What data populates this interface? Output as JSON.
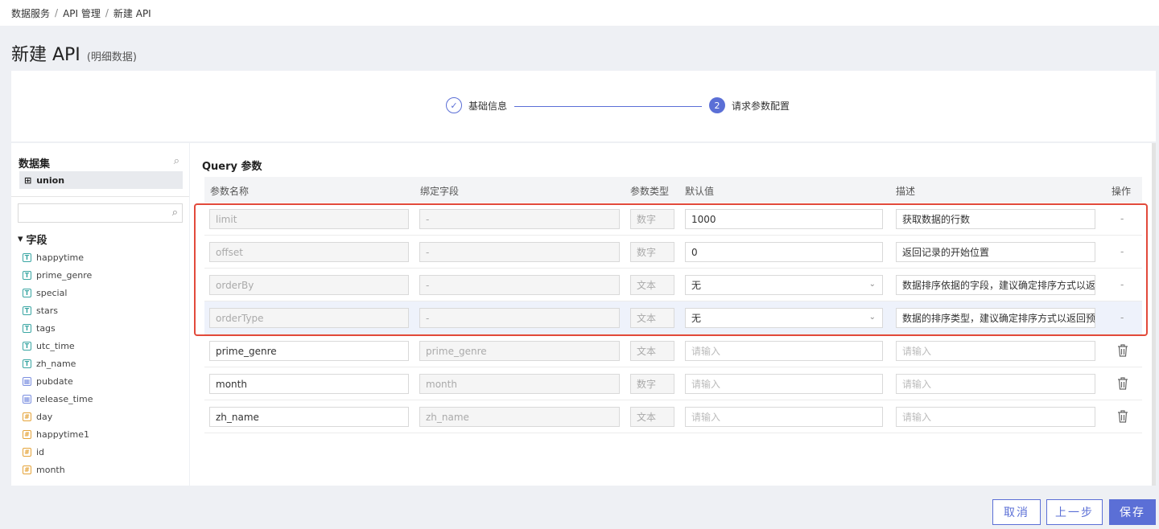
{
  "breadcrumb": [
    "数据服务",
    "API 管理",
    "新建 API"
  ],
  "page": {
    "title": "新建 API",
    "subtitle": "(明细数据)"
  },
  "steps": [
    {
      "label": "基础信息",
      "status": "done"
    },
    {
      "label": "请求参数配置",
      "number": "2",
      "status": "active"
    }
  ],
  "dataset": {
    "header": "数据集",
    "item": "union",
    "fields_group": "字段"
  },
  "fields": [
    {
      "name": "happytime",
      "type": "T"
    },
    {
      "name": "prime_genre",
      "type": "T"
    },
    {
      "name": "special",
      "type": "T"
    },
    {
      "name": "stars",
      "type": "T"
    },
    {
      "name": "tags",
      "type": "T"
    },
    {
      "name": "utc_time",
      "type": "T"
    },
    {
      "name": "zh_name",
      "type": "T"
    },
    {
      "name": "pubdate",
      "type": "date"
    },
    {
      "name": "release_time",
      "type": "date"
    },
    {
      "name": "day",
      "type": "#"
    },
    {
      "name": "happytime1",
      "type": "#"
    },
    {
      "name": "id",
      "type": "#"
    },
    {
      "name": "month",
      "type": "#"
    }
  ],
  "query": {
    "title": "Query 参数",
    "headers": [
      "参数名称",
      "绑定字段",
      "参数类型",
      "默认值",
      "描述",
      "操作"
    ],
    "rows": [
      {
        "name": "limit",
        "bind": "-",
        "type": "数字",
        "default": "1000",
        "desc": "获取数据的行数",
        "op": "-"
      },
      {
        "name": "offset",
        "bind": "-",
        "type": "数字",
        "default": "0",
        "desc": "返回记录的开始位置",
        "op": "-"
      },
      {
        "name": "orderBy",
        "bind": "-",
        "type": "文本",
        "default": "无",
        "desc": "数据排序依据的字段，建议确定排序方式以返",
        "op": "-"
      },
      {
        "name": "orderType",
        "bind": "-",
        "type": "文本",
        "default": "无",
        "desc": "数据的排序类型，建议确定排序方式以返回预",
        "op": "-"
      },
      {
        "name": "prime_genre",
        "bind": "prime_genre",
        "type": "文本",
        "default": "请输入",
        "desc": "请输入",
        "op": ""
      },
      {
        "name": "month",
        "bind": "month",
        "type": "数字",
        "default": "请输入",
        "desc": "请输入",
        "op": ""
      },
      {
        "name": "zh_name",
        "bind": "zh_name",
        "type": "文本",
        "default": "请输入",
        "desc": "请输入",
        "op": ""
      }
    ]
  },
  "buttons": {
    "cancel": "取消",
    "prev": "上一步",
    "save": "保存"
  },
  "colors": {
    "accent": "#5b6fd6",
    "highlight": "#e24a3b"
  }
}
